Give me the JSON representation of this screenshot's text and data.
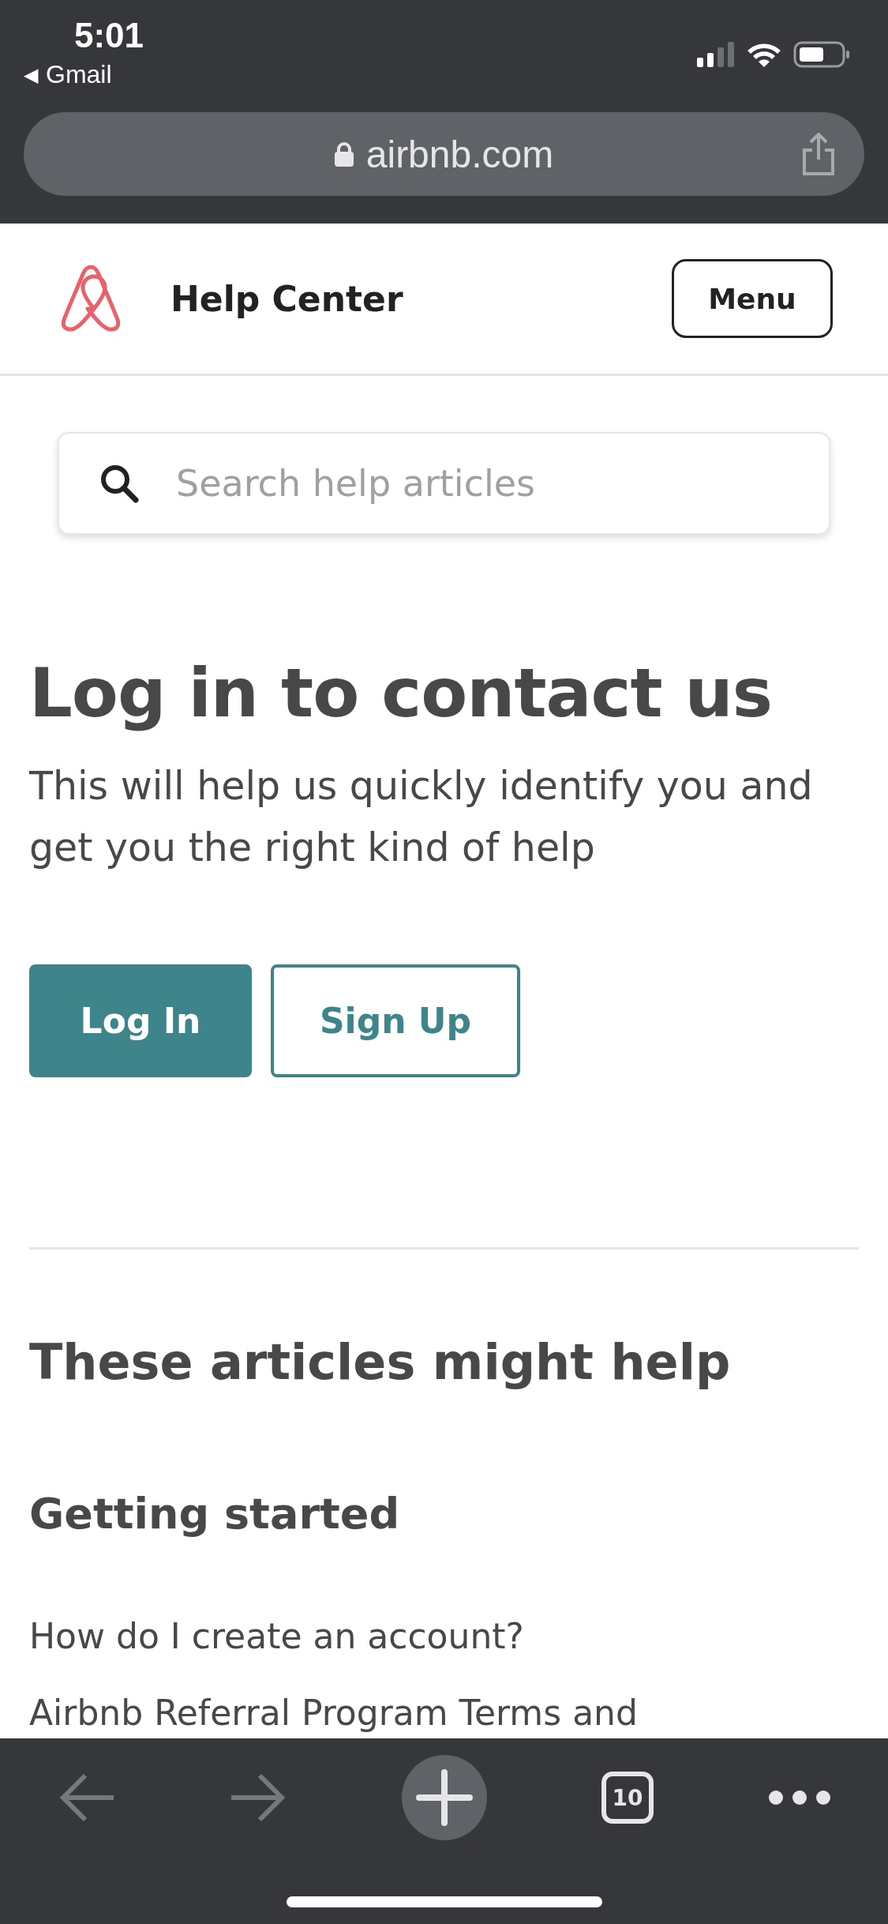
{
  "status_bar": {
    "time": "5:01",
    "back_app": "Gmail",
    "back_arrow": "◀"
  },
  "address_bar": {
    "url": "airbnb.com"
  },
  "header": {
    "title": "Help Center",
    "menu_button": "Menu"
  },
  "search": {
    "placeholder": "Search help articles"
  },
  "login_section": {
    "heading": "Log in to contact us",
    "description": "This will help us quickly identify you and get you the right kind of help",
    "buttons": [
      {
        "label": "Log In",
        "kind": "primary"
      },
      {
        "label": "Sign Up",
        "kind": "outline"
      }
    ]
  },
  "articles": {
    "heading": "These articles might help",
    "subheading": "Getting started",
    "links": [
      "How do I create an account?",
      "Airbnb Referral Program Terms and"
    ]
  },
  "toolbar": {
    "tab_count": "10",
    "back_disabled": true,
    "forward_disabled": true
  }
}
